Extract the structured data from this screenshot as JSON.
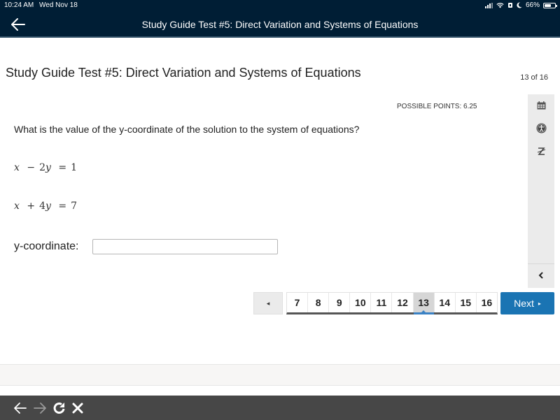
{
  "status_bar": {
    "time": "10:24 AM",
    "date": "Wed Nov 18",
    "battery_percent": "66%",
    "battery_level": 0.66,
    "icons": [
      "signal-icon",
      "wifi-icon",
      "orientation-lock-icon",
      "do-not-disturb-moon-icon",
      "battery-icon"
    ]
  },
  "navbar": {
    "back_icon": "arrow-left-icon",
    "title": "Study Guide Test #5: Direct Variation and Systems of Equations"
  },
  "page": {
    "title": "Study Guide Test #5: Direct Variation and Systems of Equations",
    "counter": "13 of 16",
    "possible_points": "POSSIBLE POINTS: 6.25"
  },
  "sidebar": {
    "tools": [
      {
        "name": "calendar-icon",
        "label": "Calendar"
      },
      {
        "name": "accessibility-icon",
        "label": "Accessibility"
      },
      {
        "name": "translate-icon",
        "label": "Translate"
      }
    ],
    "collapse_icon": "chevron-left-icon"
  },
  "question": {
    "prompt": "What is the value of the y-coordinate of the solution to the system of equations?",
    "equations": [
      {
        "lhs_var1": "x",
        "op": "−",
        "coef": "2",
        "var2": "y",
        "eq": "=",
        "rhs": "1"
      },
      {
        "lhs_var1": "x",
        "op": "+",
        "coef": "4",
        "var2": "y",
        "eq": "=",
        "rhs": "7"
      }
    ],
    "answer_label": "y-coordinate:",
    "answer_value": "",
    "answer_placeholder": ""
  },
  "pagination": {
    "prev_label": "◂",
    "pages": [
      "7",
      "8",
      "9",
      "10",
      "11",
      "12",
      "13",
      "14",
      "15",
      "16"
    ],
    "current": "13",
    "next_label": "Next",
    "next_icon": "▸",
    "accent_color": "#1a74b3"
  },
  "browser_bar": {
    "buttons": [
      "back-arrow-icon",
      "forward-arrow-icon",
      "reload-icon",
      "close-icon"
    ]
  }
}
